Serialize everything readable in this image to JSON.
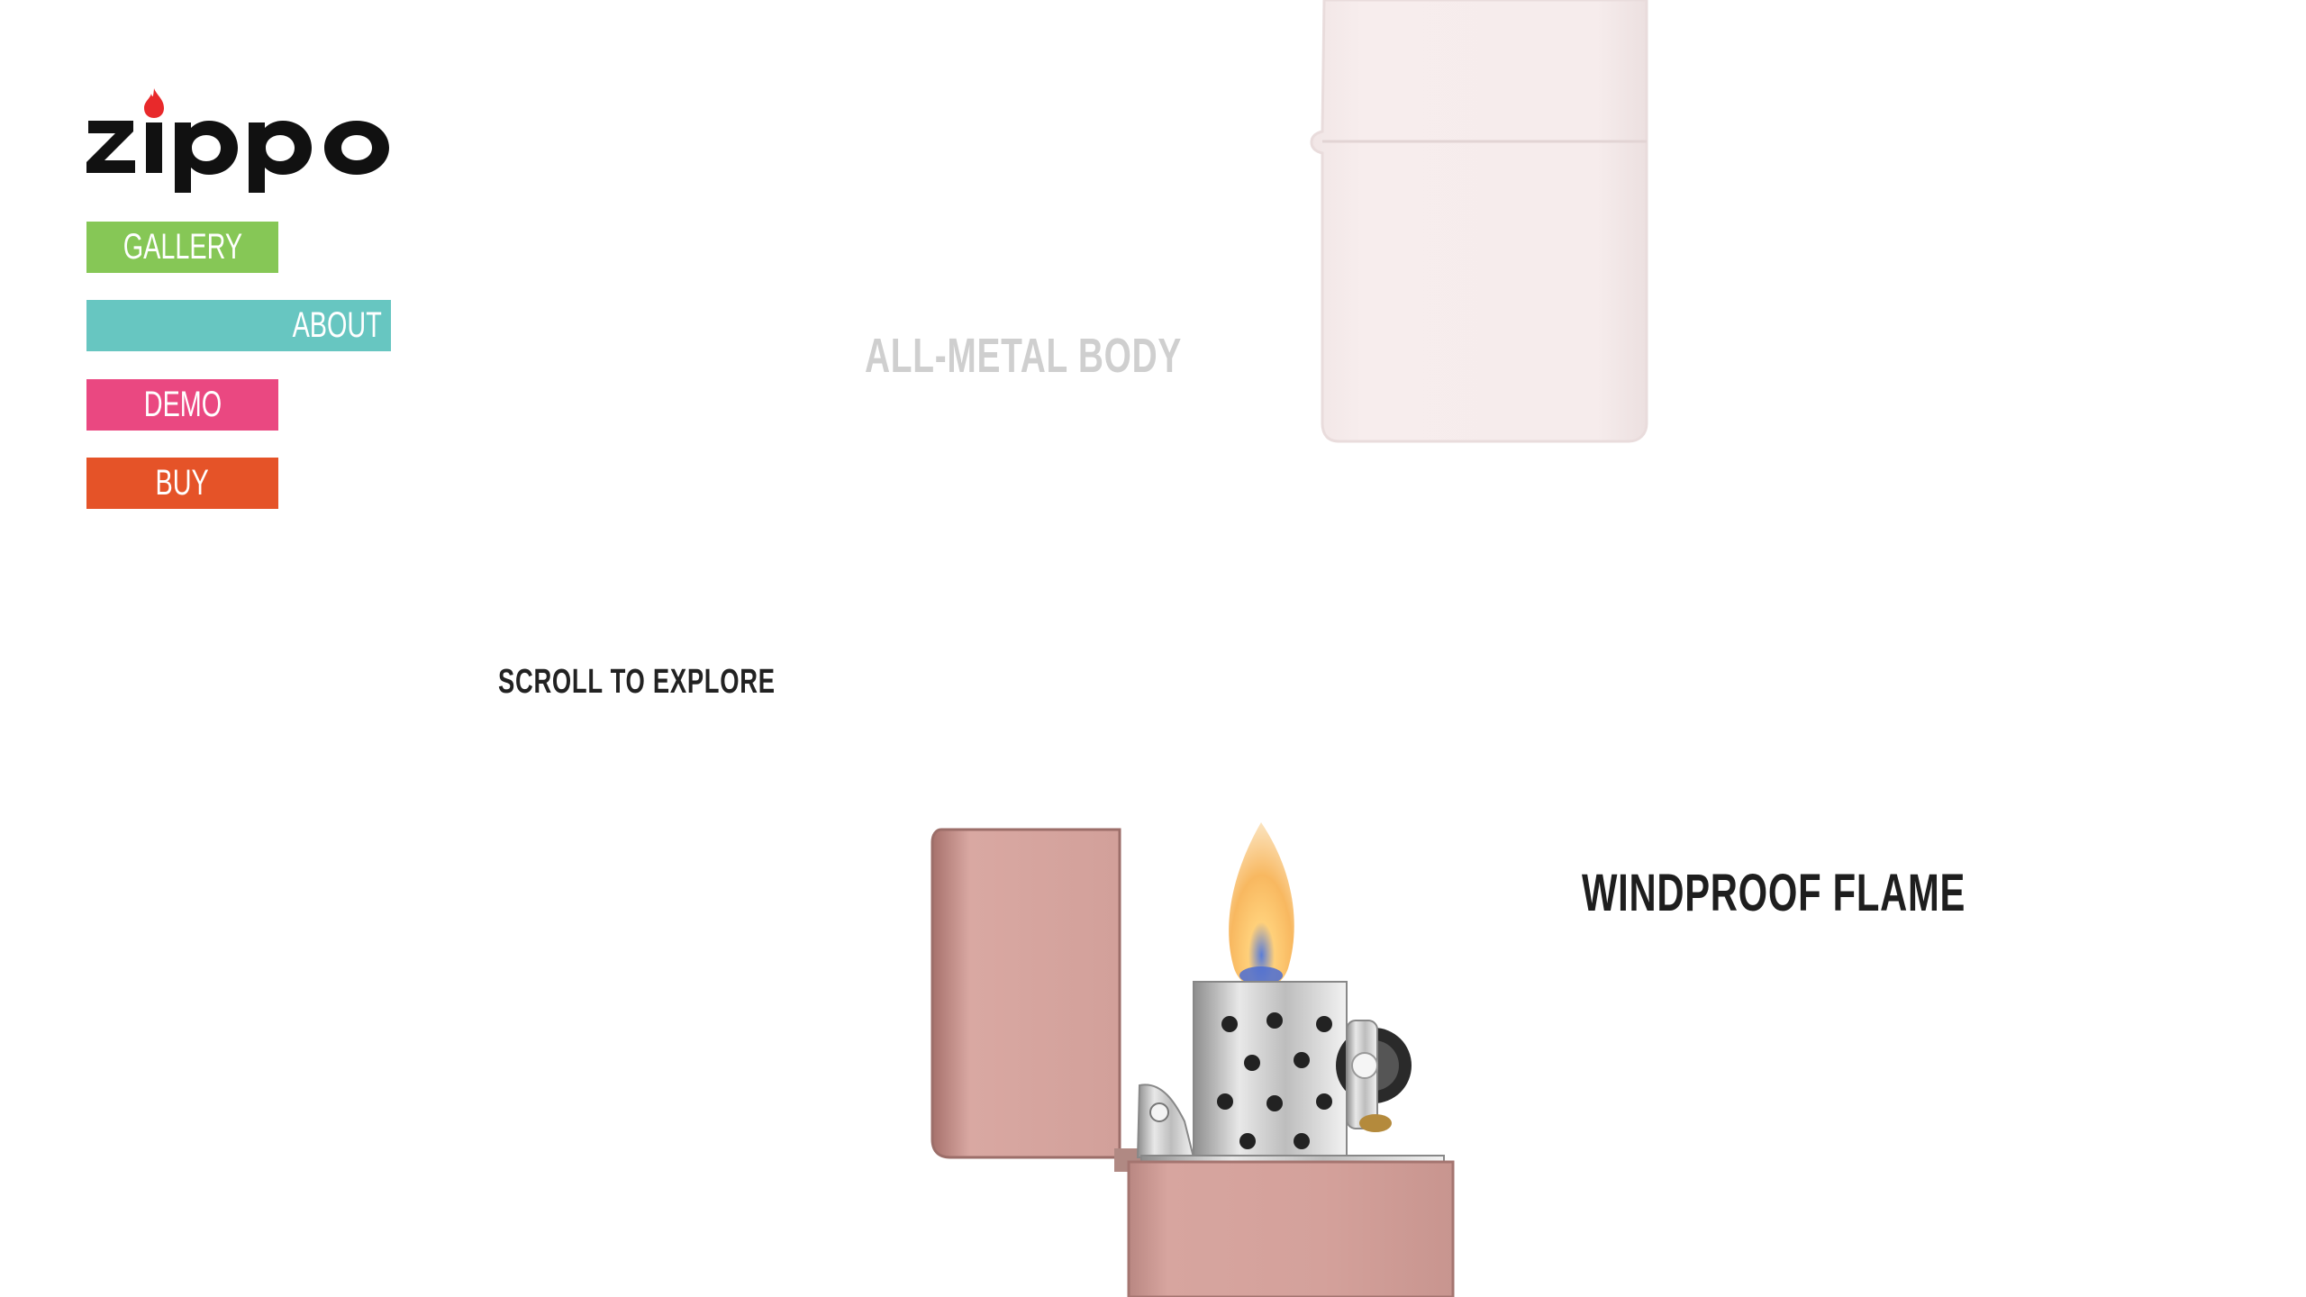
{
  "brand": {
    "logo_text": "zippo",
    "logo_color": "#111111",
    "flame_color": "#e8292b"
  },
  "nav": {
    "gallery": {
      "label": "GALLERY",
      "color": "#86c756"
    },
    "about": {
      "label": "ABOUT",
      "color": "#67c6c1"
    },
    "demo": {
      "label": "DEMO",
      "color": "#ea4881"
    },
    "buy": {
      "label": "BUY",
      "color": "#e55328"
    }
  },
  "features": {
    "metal_body": "ALL-METAL BODY",
    "windproof_flame": "WINDPROOF FLAME"
  },
  "scroll_hint": "SCROLL TO EXPLORE",
  "images": {
    "top_lighter": "closed-white-lighter",
    "bottom_lighter": "open-pink-lighter-with-flame"
  }
}
